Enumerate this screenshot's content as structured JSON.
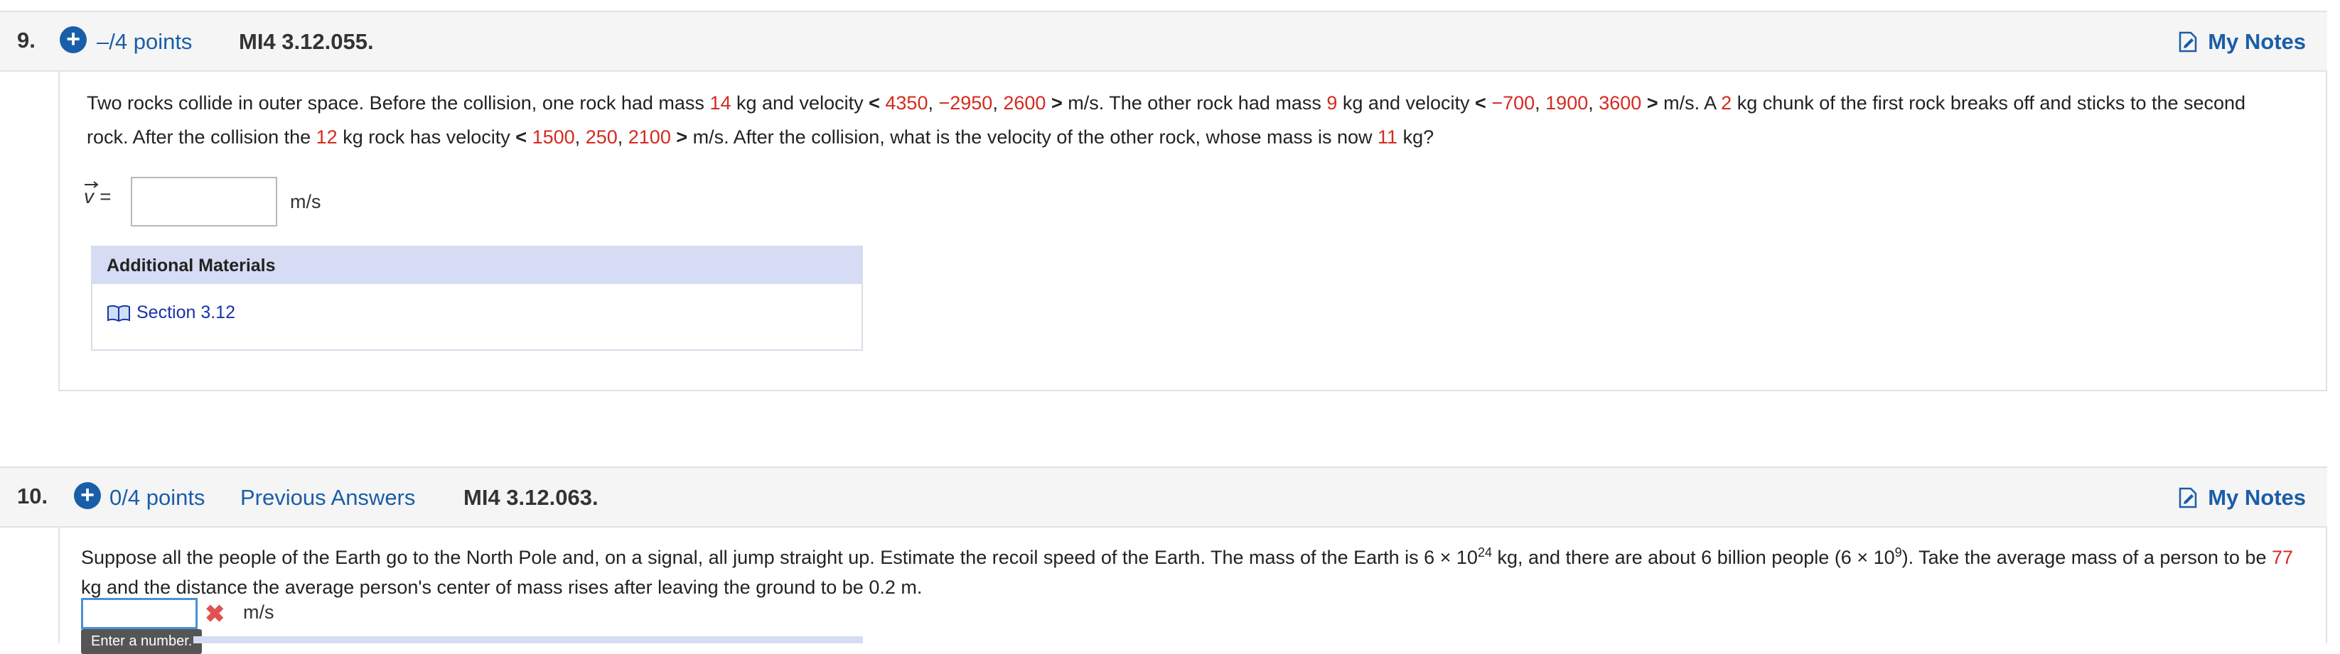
{
  "q9": {
    "number": "9.",
    "points": "–/4 points",
    "code": "MI4 3.12.055.",
    "notes": "My Notes",
    "text": {
      "p1": "Two rocks collide in outer space. Before the collision, one rock had mass ",
      "m1": "14",
      "p2": " kg and velocity ",
      "lt1": "<",
      "v1a": "4350",
      "c1": ", ",
      "v1b": "−2950",
      "c2": ", ",
      "v1c": "2600",
      "gt1": ">",
      "p3": " m/s. The other rock had mass ",
      "m2": "9",
      "p4": " kg and velocity ",
      "lt2": "<",
      "v2a": "−700",
      "c3": ", ",
      "v2b": "1900",
      "c4": ", ",
      "v2c": "3600",
      "gt2": ">",
      "p5": " m/s. A ",
      "chunk": "2",
      "p6": " kg chunk of the first rock breaks off and sticks to the second rock. After the collision the ",
      "m3": "12",
      "p7": " kg rock has velocity ",
      "lt3": "<",
      "v3a": "1500",
      "c5": ", ",
      "v3b": "250",
      "c6": ", ",
      "v3c": "2100",
      "gt3": ">",
      "p8": " m/s. After the collision, what is the velocity of the other rock, whose mass is now ",
      "m4": "11",
      "p9": " kg?"
    },
    "answer_label": "v =",
    "answer_value": "",
    "unit": "m/s",
    "additional_materials": "Additional Materials",
    "section_link": "Section 3.12"
  },
  "q10": {
    "number": "10.",
    "points": "0/4 points",
    "previous_answers": "Previous Answers",
    "code": "MI4 3.12.063.",
    "notes": "My Notes",
    "text": {
      "p1": "Suppose all the people of the Earth go to the North Pole and, on a signal, all jump straight up. Estimate the recoil speed of the Earth. The mass of the Earth is 6 × 10",
      "exp1": "24",
      "p2": " kg, and there are about 6 billion people (6 × 10",
      "exp2": "9",
      "p3": "). Take the average mass of a person to be ",
      "mass": "77",
      "p4": " kg and the distance the average person's center of mass rises after leaving the ground to be 0.2 m."
    },
    "answer_value": "",
    "unit": "m/s",
    "tooltip": "Enter a number."
  },
  "colors": {
    "link_blue": "#1a5ea8",
    "value_red": "#d42a20",
    "header_bg": "#f5f5f5",
    "materials_head_bg": "#d6dcf3",
    "error_red": "#e05252"
  }
}
